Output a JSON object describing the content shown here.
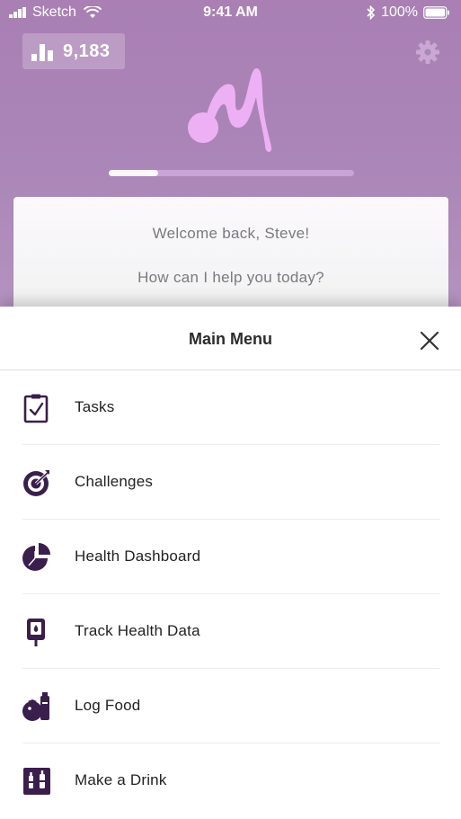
{
  "status_bar": {
    "carrier": "Sketch",
    "time": "9:41 AM",
    "battery": "100%",
    "icons": [
      "signal-icon",
      "wifi-icon",
      "bluetooth-icon",
      "battery-icon"
    ]
  },
  "header": {
    "steps_count": "9,183",
    "steps_icon": "bar-chart-icon",
    "settings_icon": "gear-icon",
    "progress_fraction": 0.2
  },
  "welcome": {
    "greeting": "Welcome back, Steve!",
    "prompt": "How can I help you today?"
  },
  "menu": {
    "title": "Main Menu",
    "close_icon": "close-icon",
    "items": [
      {
        "label": "Tasks",
        "icon": "clipboard-check-icon"
      },
      {
        "label": "Challenges",
        "icon": "target-icon"
      },
      {
        "label": "Health Dashboard",
        "icon": "pie-chart-icon"
      },
      {
        "label": "Track Health Data",
        "icon": "glucose-meter-icon"
      },
      {
        "label": "Log Food",
        "icon": "food-icon"
      },
      {
        "label": "Make a Drink",
        "icon": "drink-icon"
      }
    ]
  },
  "colors": {
    "hero_purple": "#a97fb4",
    "logo_pink": "#eeb0f5",
    "icon_purple": "#3a1e4c",
    "progress_track": "#c9a4d7"
  }
}
